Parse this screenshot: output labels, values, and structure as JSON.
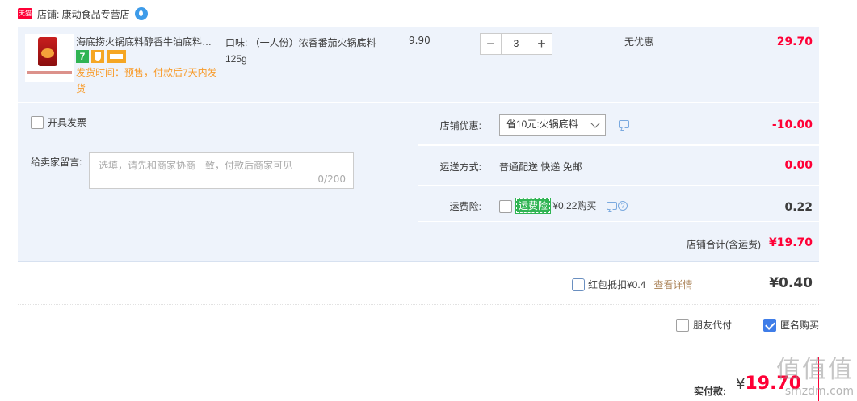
{
  "shop": {
    "tmall_badge": "天猫",
    "label": "店铺: 康动食品专营店"
  },
  "item": {
    "title": "海底捞火锅底料醇香牛油底料番茄火锅底料",
    "ship_note": "发货时间：预售，付款后7天内发货",
    "badge_seven": "7",
    "sku": "口味: （一人份）浓香番茄火锅底料125g",
    "unit_price": "9.90",
    "quantity": "3",
    "qty_minus": "−",
    "qty_plus": "+",
    "promo": "无优惠",
    "total": "29.70"
  },
  "options": {
    "invoice_label": "开具发票",
    "memo_label": "给卖家留言:",
    "memo_placeholder": "选填，请先和商家协商一致，付款后商家可见",
    "memo_count": "0/200",
    "coupon_label": "店铺优惠:",
    "coupon_value": "省10元:火锅底料",
    "coupon_amount": "-10.00",
    "shipping_label": "运送方式:",
    "shipping_value": "普通配送 快递 免邮",
    "shipping_amount": "0.00",
    "insurance_label": "运费险:",
    "insurance_badge": "运费险",
    "insurance_text": "¥0.22购买",
    "insurance_amount": "0.22"
  },
  "summary": {
    "shop_total_label": "店铺合计(含运费)",
    "shop_total_value": "¥19.70",
    "redpack_label": "红包抵扣¥0.4",
    "redpack_link": "查看详情",
    "redpack_amount": "¥0.40",
    "friend_pay_label": "朋友代付",
    "anon_buy_label": "匿名购买",
    "pay_label": "实付款:",
    "pay_currency": "¥",
    "pay_amount": "19.70"
  },
  "watermark": {
    "glyphs": "值值值",
    "url": "smzdm.com"
  },
  "colors": {
    "price_red": "#ff0036",
    "row_bg": "#eef3fb",
    "notice_orange": "#f89b2a",
    "badge_green": "#30b453",
    "check_blue": "#3f7de8"
  }
}
